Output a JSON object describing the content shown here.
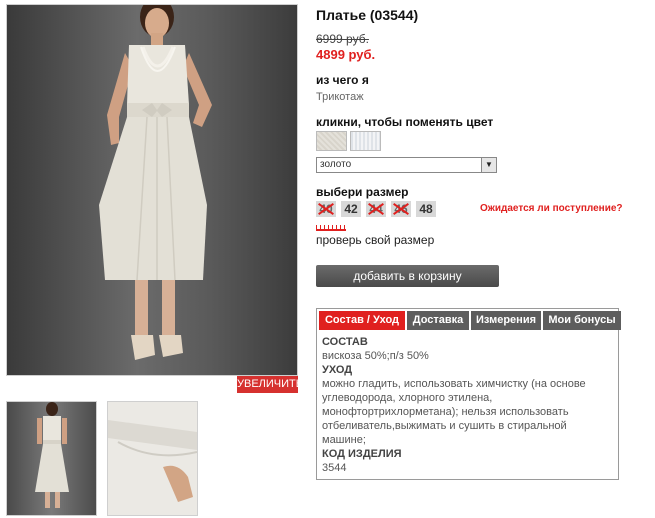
{
  "product": {
    "title": "Платье (03544)",
    "old_price": "6999 руб.",
    "new_price": "4899 руб."
  },
  "gallery": {
    "zoom_label": "УВЕЛИЧИТЬ"
  },
  "material_section": {
    "label": "из чего я",
    "value": "Трикотаж"
  },
  "color_section": {
    "label": "кликни, чтобы поменять цвет",
    "selected": "золото"
  },
  "size_section": {
    "label": "выбери размер",
    "sizes": [
      {
        "value": "40",
        "available": false
      },
      {
        "value": "42",
        "available": true
      },
      {
        "value": "44",
        "available": false
      },
      {
        "value": "46",
        "available": false
      },
      {
        "value": "48",
        "available": true
      }
    ],
    "awaiting_link": "Ожидается ли поступление?",
    "check_size_link": "проверь свой размер"
  },
  "cart": {
    "add_label": "добавить в корзину"
  },
  "tabs": {
    "items": [
      "Состав / Уход",
      "Доставка",
      "Измерения",
      "Мои бонусы"
    ],
    "active": "Состав / Уход",
    "content": {
      "composition_heading": "СОСТАВ",
      "composition_text": "вискоза 50%;п/з 50%",
      "care_heading": "УХОД",
      "care_text": "можно гладить, использовать химчистку (на основе углеводорода, хлорного этилена, монофтортрихлорметана); нельзя использовать отбеливатель,выжимать и сушить в стиральной машине;",
      "code_heading": "КОД ИЗДЕЛИЯ",
      "code_value": "3544"
    }
  },
  "colors": {
    "accent": "#e0201f",
    "button_dark": "#5d5d5d"
  }
}
